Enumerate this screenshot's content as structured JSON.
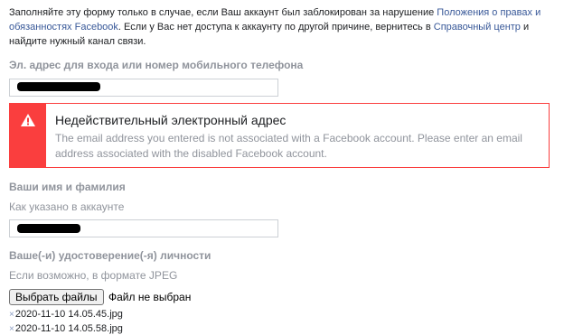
{
  "intro": {
    "part1": "Заполняйте эту форму только в случае, если Ваш аккаунт был заблокирован за нарушение ",
    "link_terms": "Положения о правах и обязанностях Facebook",
    "part2": ". Если у Вас нет доступа к аккаунту по другой причине, вернитесь в ",
    "link_help": "Справочный центр",
    "part3": " и найдите нужный канал связи."
  },
  "email_field": {
    "label": "Эл. адрес для входа или номер мобильного телефона"
  },
  "error": {
    "title": "Недействительный электронный адрес",
    "message": "The email address you entered is not associated with a Facebook account. Please enter an email address associated with the disabled Facebook account.",
    "color": "#fa3e3e"
  },
  "name_field": {
    "label": "Ваши имя и фамилия",
    "hint": "Как указано в аккаунте"
  },
  "id_field": {
    "label": "Ваше(-и) удостоверение(-я) личности",
    "hint": "Если возможно, в формате JPEG",
    "button_label": "Выбрать файлы",
    "status": "Файл не выбран"
  },
  "attachments": [
    {
      "remove_icon": "×",
      "name": "2020-11-10 14.05.45.jpg"
    },
    {
      "remove_icon": "×",
      "name": "2020-11-10 14.05.58.jpg"
    }
  ],
  "colors": {
    "link": "#385898",
    "label_gray": "#90949c",
    "error_red": "#fa3e3e"
  }
}
